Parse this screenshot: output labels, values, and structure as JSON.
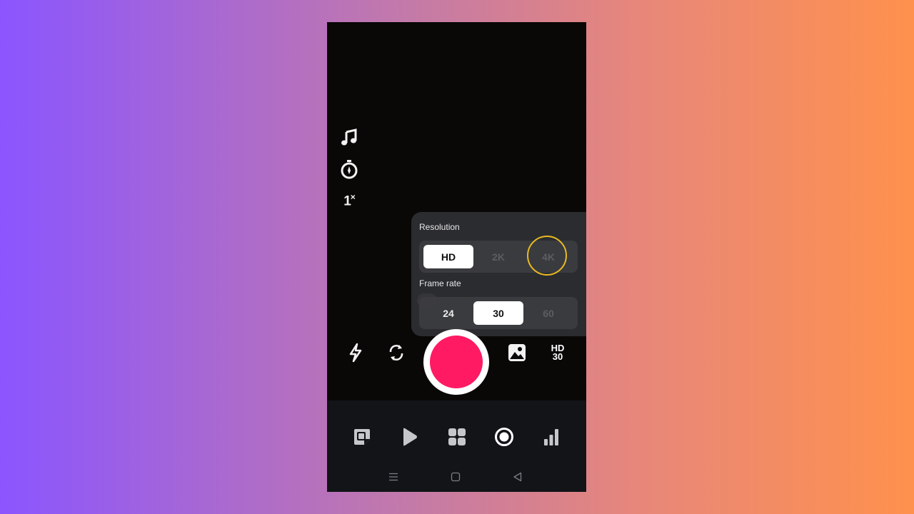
{
  "side_tools": [
    {
      "icon": "music-note-icon"
    },
    {
      "icon": "timer-icon"
    },
    {
      "icon": "speed-icon",
      "label": "1",
      "suffix": "×"
    }
  ],
  "settings_panel": {
    "resolution_label": "Resolution",
    "resolution_options": [
      "HD",
      "2K",
      "4K"
    ],
    "resolution_selected": "HD",
    "frame_rate_label": "Frame rate",
    "frame_rate_options": [
      "24",
      "30",
      "60"
    ],
    "frame_rate_selected": "30"
  },
  "controls": {
    "flash_icon": "flash-icon",
    "flip_icon": "flip-camera-icon",
    "record_color": "#ff1a63",
    "gallery_icon": "gallery-icon",
    "quality_top": "HD",
    "quality_bottom": "30"
  },
  "bottom_nav": [
    {
      "icon": "sticker-icon"
    },
    {
      "icon": "play-icon"
    },
    {
      "icon": "grid-icon"
    },
    {
      "icon": "record-icon",
      "active": true
    },
    {
      "icon": "stats-icon"
    }
  ],
  "system_bar": [
    "menu-icon",
    "home-icon",
    "back-icon"
  ],
  "colors": {
    "accent": "#ff1a63",
    "highlight": "#e8b923"
  }
}
